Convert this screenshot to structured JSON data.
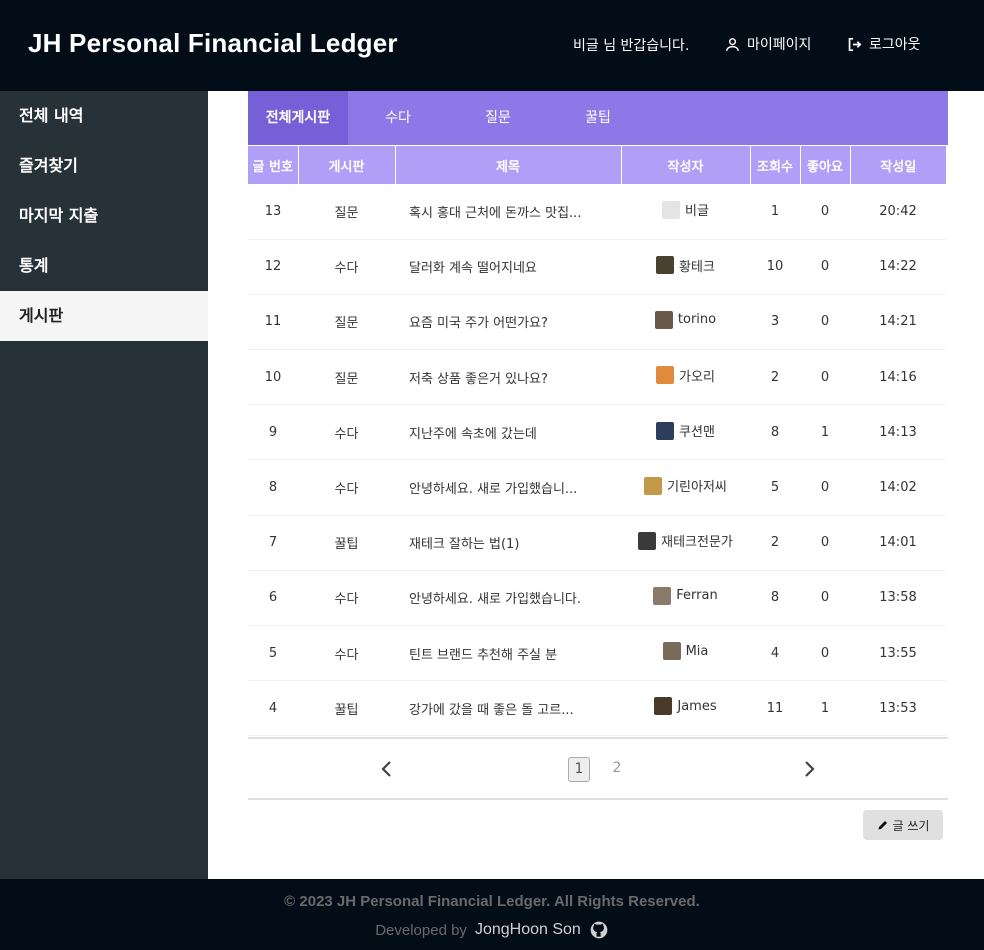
{
  "header": {
    "brand": "JH Personal Financial Ledger",
    "greeting": "비글 님 반갑습니다.",
    "mypage_label": "마이페이지",
    "logout_label": "로그아웃"
  },
  "sidebar": {
    "items": [
      {
        "label": "전체 내역"
      },
      {
        "label": "즐겨찾기"
      },
      {
        "label": "마지막 지출"
      },
      {
        "label": "통계"
      },
      {
        "label": "게시판"
      }
    ]
  },
  "tabs": [
    {
      "label": "전체게시판"
    },
    {
      "label": "수다"
    },
    {
      "label": "질문"
    },
    {
      "label": "꿀팁"
    }
  ],
  "table": {
    "columns": [
      "글 번호",
      "게시판",
      "제목",
      "작성자",
      "조회수",
      "좋아요",
      "작성일"
    ],
    "rows": [
      {
        "no": "13",
        "board": "질문",
        "title": "혹시 홍대 근처에 돈까스 맛집...",
        "author": "비글",
        "views": "1",
        "likes": "0",
        "date": "20:42",
        "avatar_color": "#e4e4e4"
      },
      {
        "no": "12",
        "board": "수다",
        "title": "달러화 계속 떨어지네요",
        "author": "황테크",
        "views": "10",
        "likes": "0",
        "date": "14:22",
        "avatar_color": "#4a4030"
      },
      {
        "no": "11",
        "board": "질문",
        "title": "요즘 미국 주가 어떤가요?",
        "author": "torino",
        "views": "3",
        "likes": "0",
        "date": "14:21",
        "avatar_color": "#6b5a4a"
      },
      {
        "no": "10",
        "board": "질문",
        "title": "저축 상품 좋은거 있나요?",
        "author": "가오리",
        "views": "2",
        "likes": "0",
        "date": "14:16",
        "avatar_color": "#e08a3c"
      },
      {
        "no": "9",
        "board": "수다",
        "title": "지난주에 속초에 갔는데",
        "author": "쿠션맨",
        "views": "8",
        "likes": "1",
        "date": "14:13",
        "avatar_color": "#2c3e5a"
      },
      {
        "no": "8",
        "board": "수다",
        "title": "안녕하세요. 새로 가입했습니...",
        "author": "기린아저씨",
        "views": "5",
        "likes": "0",
        "date": "14:02",
        "avatar_color": "#c49a4a"
      },
      {
        "no": "7",
        "board": "꿀팁",
        "title": "재테크 잘하는 법(1)",
        "author": "재테크전문가",
        "views": "2",
        "likes": "0",
        "date": "14:01",
        "avatar_color": "#3a3a3a"
      },
      {
        "no": "6",
        "board": "수다",
        "title": "안녕하세요. 새로 가입했습니다.",
        "author": "Ferran",
        "views": "8",
        "likes": "0",
        "date": "13:58",
        "avatar_color": "#8a7a6a"
      },
      {
        "no": "5",
        "board": "수다",
        "title": "틴트 브랜드 추천해 주실 분",
        "author": "Mia",
        "views": "4",
        "likes": "0",
        "date": "13:55",
        "avatar_color": "#7a6a5a"
      },
      {
        "no": "4",
        "board": "꿀팁",
        "title": "강가에 갔을 때 좋은 돌 고르...",
        "author": "James",
        "views": "11",
        "likes": "1",
        "date": "13:53",
        "avatar_color": "#4a3a2a"
      }
    ]
  },
  "pagination": {
    "pages": [
      "1",
      "2"
    ],
    "current": "1"
  },
  "write_label": "글 쓰기",
  "footer": {
    "copyright": "© 2023 JH Personal Financial Ledger. All Rights Reserved.",
    "developed_by": "Developed by",
    "developer": "JongHoon Son"
  }
}
